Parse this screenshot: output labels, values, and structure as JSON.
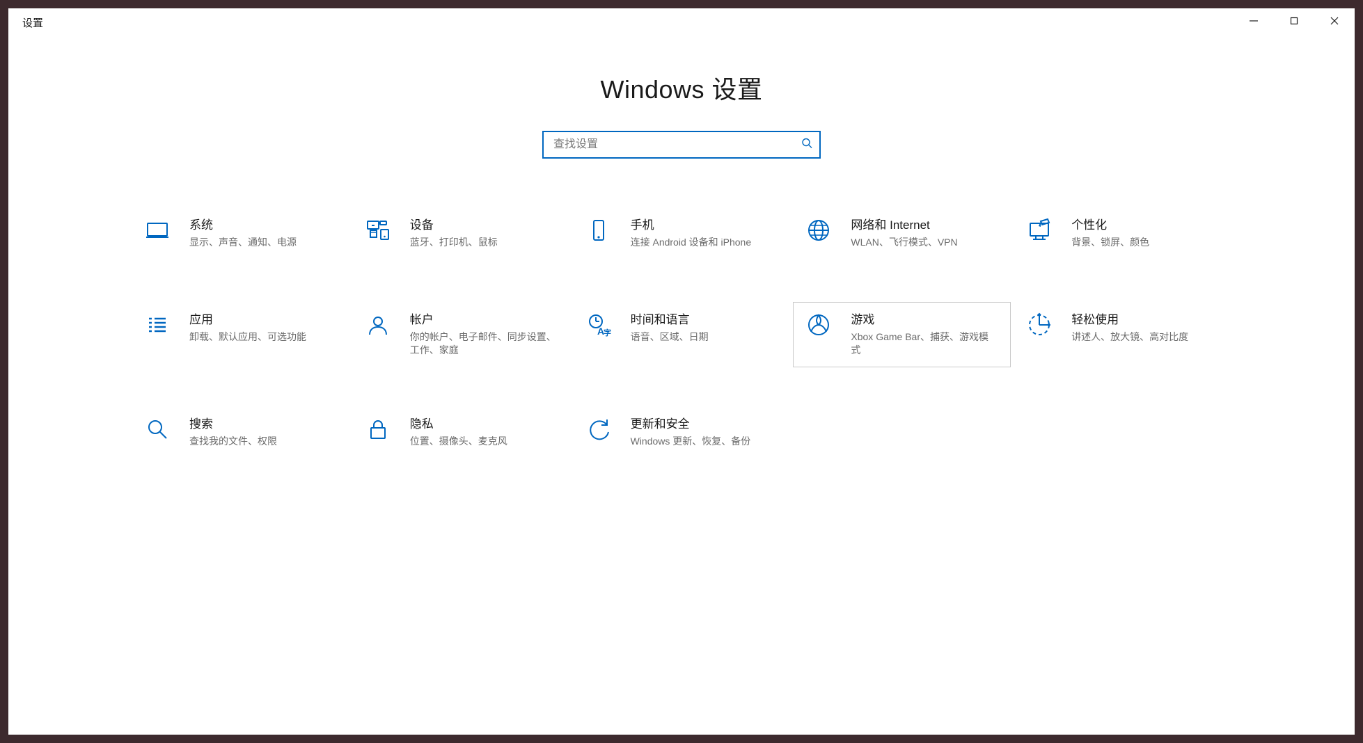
{
  "window": {
    "title": "设置"
  },
  "header": {
    "page_title": "Windows 设置"
  },
  "search": {
    "placeholder": "查找设置"
  },
  "tiles": [
    {
      "id": "system",
      "title": "系统",
      "desc": "显示、声音、通知、电源",
      "hover": false
    },
    {
      "id": "devices",
      "title": "设备",
      "desc": "蓝牙、打印机、鼠标",
      "hover": false
    },
    {
      "id": "phone",
      "title": "手机",
      "desc": "连接 Android 设备和 iPhone",
      "hover": false
    },
    {
      "id": "network",
      "title": "网络和 Internet",
      "desc": "WLAN、飞行模式、VPN",
      "hover": false
    },
    {
      "id": "personalize",
      "title": "个性化",
      "desc": "背景、锁屏、颜色",
      "hover": false
    },
    {
      "id": "apps",
      "title": "应用",
      "desc": "卸载、默认应用、可选功能",
      "hover": false
    },
    {
      "id": "accounts",
      "title": "帐户",
      "desc": "你的帐户、电子邮件、同步设置、工作、家庭",
      "hover": false
    },
    {
      "id": "time",
      "title": "时间和语言",
      "desc": "语音、区域、日期",
      "hover": false
    },
    {
      "id": "gaming",
      "title": "游戏",
      "desc": "Xbox Game Bar、捕获、游戏模式",
      "hover": true
    },
    {
      "id": "ease",
      "title": "轻松使用",
      "desc": "讲述人、放大镜、高对比度",
      "hover": false
    },
    {
      "id": "search",
      "title": "搜索",
      "desc": "查找我的文件、权限",
      "hover": false
    },
    {
      "id": "privacy",
      "title": "隐私",
      "desc": "位置、摄像头、麦克风",
      "hover": false
    },
    {
      "id": "update",
      "title": "更新和安全",
      "desc": "Windows 更新、恢复、备份",
      "hover": false
    }
  ]
}
